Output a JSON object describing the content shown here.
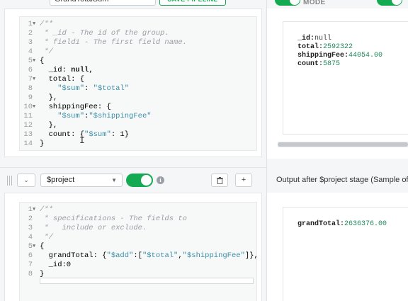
{
  "header": {
    "pipeline_name": "GrandTotalSum",
    "save_label": "SAVE PIPELINE",
    "mode_label": "MODE"
  },
  "group_stage": {
    "code_lines": [
      {
        "n": "1",
        "fold": true,
        "text": "/**"
      },
      {
        "n": "2",
        "fold": false,
        "text": " * _id - The id of the group."
      },
      {
        "n": "3",
        "fold": false,
        "text": " * field1 - The first field name."
      },
      {
        "n": "4",
        "fold": false,
        "text": " */"
      },
      {
        "n": "5",
        "fold": true,
        "text": "{"
      },
      {
        "n": "6",
        "fold": false,
        "text": "  _id: null,"
      },
      {
        "n": "7",
        "fold": true,
        "text": "  total: {"
      },
      {
        "n": "8",
        "fold": false,
        "text": "    \"$sum\": \"$total\""
      },
      {
        "n": "9",
        "fold": false,
        "text": "  },"
      },
      {
        "n": "10",
        "fold": true,
        "text": "  shippingFee: {"
      },
      {
        "n": "11",
        "fold": false,
        "text": "    \"$sum\":\"$shippingFee\""
      },
      {
        "n": "12",
        "fold": false,
        "text": "  },"
      },
      {
        "n": "13",
        "fold": false,
        "text": "  count: {\"$sum\": 1}"
      },
      {
        "n": "14",
        "fold": false,
        "text": "}"
      }
    ],
    "output": [
      {
        "key": "_id:",
        "value": "null"
      },
      {
        "key": "total:",
        "value": "2592322"
      },
      {
        "key": "shippingFee:",
        "value": "44054.00"
      },
      {
        "key": "count:",
        "value": "5875"
      }
    ]
  },
  "project_stage": {
    "operator": "$project",
    "collapse_symbol": "⌄",
    "info_symbol": "i",
    "delete_symbol": "🗑",
    "add_symbol": "+",
    "output_label": "Output after $project stage (Sample of",
    "code_lines": [
      {
        "n": "1",
        "fold": true,
        "text": "/**"
      },
      {
        "n": "2",
        "fold": false,
        "text": " * specifications - The fields to"
      },
      {
        "n": "3",
        "fold": false,
        "text": " *   include or exclude."
      },
      {
        "n": "4",
        "fold": false,
        "text": " */"
      },
      {
        "n": "5",
        "fold": true,
        "text": "{"
      },
      {
        "n": "6",
        "fold": false,
        "text": "  grandTotal: {\"$add\":[\"$total\",\"$shippingFee\"]},"
      },
      {
        "n": "7",
        "fold": false,
        "text": "  _id:0"
      },
      {
        "n": "8",
        "fold": false,
        "text": "}"
      }
    ],
    "output": [
      {
        "key": "grandTotal:",
        "value": "2636376.00"
      }
    ]
  },
  "colors": {
    "accent_green": "#13aa52",
    "string_blue": "#3c8fa8",
    "value_green": "#1e8a5a"
  }
}
